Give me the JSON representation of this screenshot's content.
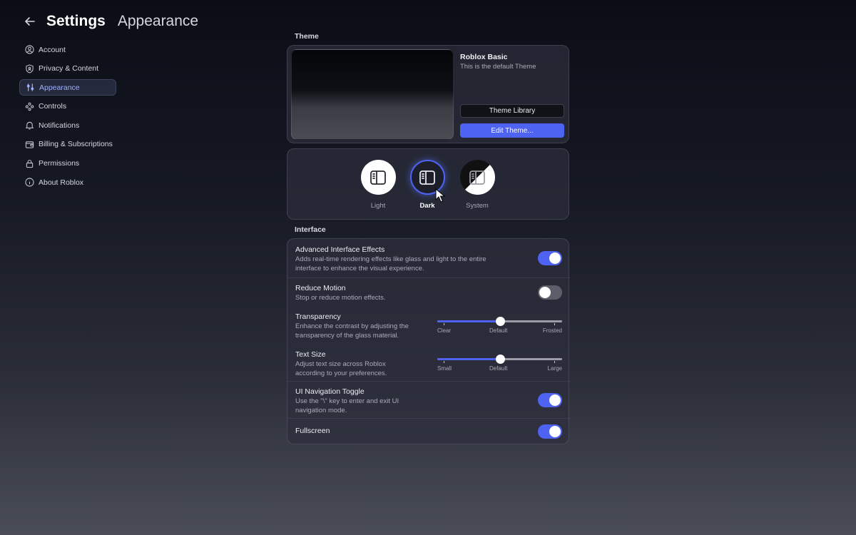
{
  "header": {
    "title": "Settings",
    "subtitle": "Appearance"
  },
  "sidebar": {
    "items": [
      {
        "label": "Account",
        "icon": "user-circle-icon"
      },
      {
        "label": "Privacy & Content",
        "icon": "shield-icon"
      },
      {
        "label": "Appearance",
        "icon": "sliders-icon",
        "active": true
      },
      {
        "label": "Controls",
        "icon": "gamepad-icon"
      },
      {
        "label": "Notifications",
        "icon": "bell-icon"
      },
      {
        "label": "Billing & Subscriptions",
        "icon": "wallet-icon"
      },
      {
        "label": "Permissions",
        "icon": "lock-icon"
      },
      {
        "label": "About Roblox",
        "icon": "info-icon"
      }
    ]
  },
  "theme": {
    "section_label": "Theme",
    "name": "Roblox Basic",
    "description": "This is the default Theme",
    "library_button": "Theme Library",
    "edit_button": "Edit Theme..."
  },
  "modes": {
    "selected": "Dark",
    "items": [
      {
        "label": "Light"
      },
      {
        "label": "Dark"
      },
      {
        "label": "System"
      }
    ]
  },
  "interface": {
    "section_label": "Interface",
    "advanced_effects": {
      "title": "Advanced Interface Effects",
      "description_1": "Adds real-time rendering effects like glass and light to the entire",
      "description_2": "interface to enhance the visual experience.",
      "enabled": true
    },
    "reduce_motion": {
      "title": "Reduce Motion",
      "description": "Stop or reduce motion effects.",
      "enabled": false
    },
    "transparency": {
      "title": "Transparency",
      "description_1": "Enhance the contrast by adjusting the",
      "description_2": "transparency of the glass material.",
      "value": 0.5,
      "labels": [
        "Clear",
        "Default",
        "Frosted"
      ]
    },
    "text_size": {
      "title": "Text Size",
      "description_1": "Adjust text size across Roblox",
      "description_2": "according to your preferences.",
      "value": 0.5,
      "labels": [
        "Small",
        "Default",
        "Large"
      ]
    },
    "ui_navigation": {
      "title": "UI Navigation Toggle",
      "description_1": "Use the \"\\\" key to enter and exit UI",
      "description_2": "navigation mode.",
      "enabled": true
    },
    "fullscreen": {
      "title": "Fullscreen",
      "enabled": true
    }
  },
  "colors": {
    "accent": "#4f63f2",
    "active_nav_text": "#9fb0ff"
  }
}
